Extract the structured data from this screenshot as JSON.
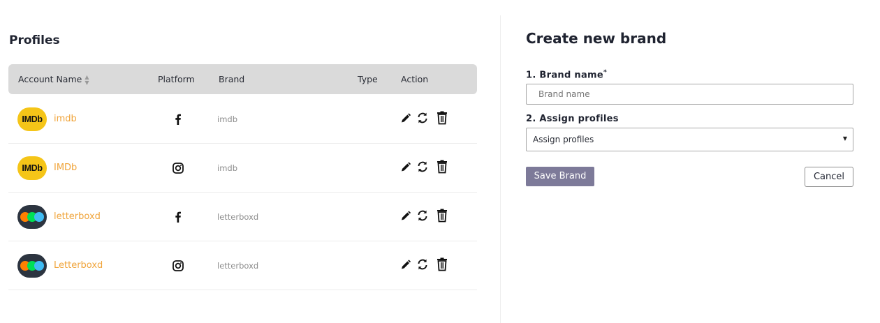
{
  "profiles": {
    "title": "Profiles",
    "columns": {
      "account_name": "Account Name",
      "sort_icon": "sort-icon",
      "platform": "Platform",
      "brand": "Brand",
      "type": "Type",
      "action": "Action"
    },
    "rows": [
      {
        "avatar": "IMDb",
        "avatar_icon": "imdb-logo-icon",
        "account_name": "imdb",
        "platform": "facebook-icon",
        "brand": "imdb",
        "type": ""
      },
      {
        "avatar": "IMDb",
        "avatar_icon": "imdb-logo-icon",
        "account_name": "IMDb",
        "platform": "instagram-icon",
        "brand": "imdb",
        "type": ""
      },
      {
        "avatar": "",
        "avatar_icon": "letterboxd-logo-icon",
        "account_name": "letterboxd",
        "platform": "facebook-icon",
        "brand": "letterboxd",
        "type": ""
      },
      {
        "avatar": "",
        "avatar_icon": "letterboxd-logo-icon",
        "account_name": "Letterboxd",
        "platform": "instagram-icon",
        "brand": "letterboxd",
        "type": ""
      }
    ],
    "action_icons": [
      "pencil-icon",
      "refresh-icon",
      "trash-icon"
    ]
  },
  "create_brand": {
    "title": "Create new brand",
    "brand_name_label": "1. Brand name",
    "required_mark": "*",
    "brand_name_placeholder": "Brand name",
    "assign_profiles_label": "2. Assign profiles",
    "assign_profiles_value": "Assign profiles",
    "save_label": "Save Brand",
    "cancel_label": "Cancel"
  },
  "colors": {
    "accent_name": "#f0a43a",
    "save_button": "#7d7a99",
    "header_bg": "#dadada",
    "imdb_yellow": "#f5c518",
    "letterboxd_bg": "#2c3440"
  }
}
